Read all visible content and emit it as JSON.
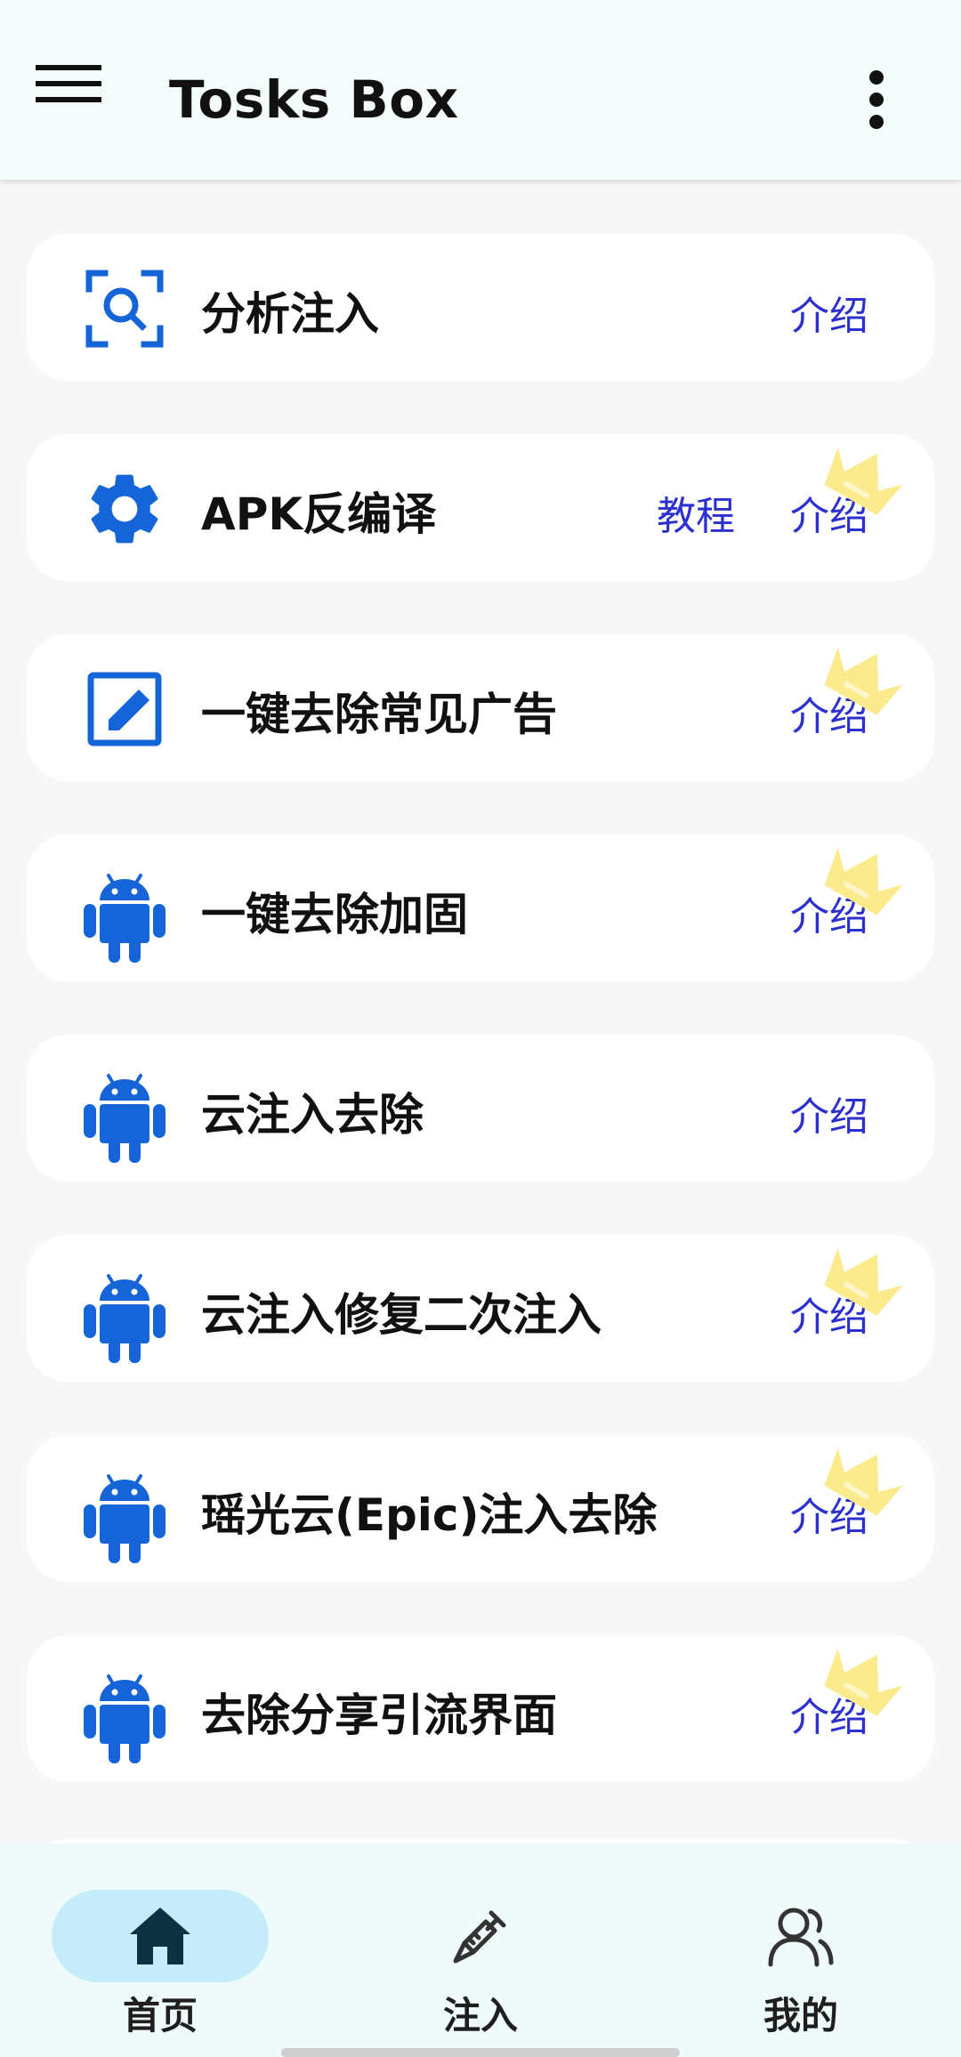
{
  "appbar": {
    "title": "Tosks Box",
    "menu_icon": "hamburger-menu-icon",
    "more_icon": "more-vertical-icon"
  },
  "colors": {
    "accent_blue": "#1565d8",
    "link_blue": "#2b30cf",
    "crown_yellow": "#fbeb8c",
    "nav_active_pill": "#c7ecf9"
  },
  "list": {
    "items": [
      {
        "label": "分析注入",
        "icon": "scan-search-icon",
        "intro": "介绍",
        "tutorial": "",
        "premium": false
      },
      {
        "label": "APK反编译",
        "icon": "gear-icon",
        "intro": "介绍",
        "tutorial": "教程",
        "premium": true
      },
      {
        "label": "一键去除常见广告",
        "icon": "edit-square-icon",
        "intro": "介绍",
        "tutorial": "",
        "premium": true
      },
      {
        "label": "一键去除加固",
        "icon": "android-icon",
        "intro": "介绍",
        "tutorial": "",
        "premium": true
      },
      {
        "label": "云注入去除",
        "icon": "android-icon",
        "intro": "介绍",
        "tutorial": "",
        "premium": false
      },
      {
        "label": "云注入修复二次注入",
        "icon": "android-icon",
        "intro": "介绍",
        "tutorial": "",
        "premium": true
      },
      {
        "label": "瑶光云(Epic)注入去除",
        "icon": "android-icon",
        "intro": "介绍",
        "tutorial": "",
        "premium": true
      },
      {
        "label": "去除分享引流界面",
        "icon": "android-icon",
        "intro": "介绍",
        "tutorial": "",
        "premium": true
      }
    ]
  },
  "bottom_nav": {
    "items": [
      {
        "label": "首页",
        "icon": "home-icon",
        "active": true
      },
      {
        "label": "注入",
        "icon": "syringe-icon",
        "active": false
      },
      {
        "label": "我的",
        "icon": "users-icon",
        "active": false
      }
    ]
  }
}
